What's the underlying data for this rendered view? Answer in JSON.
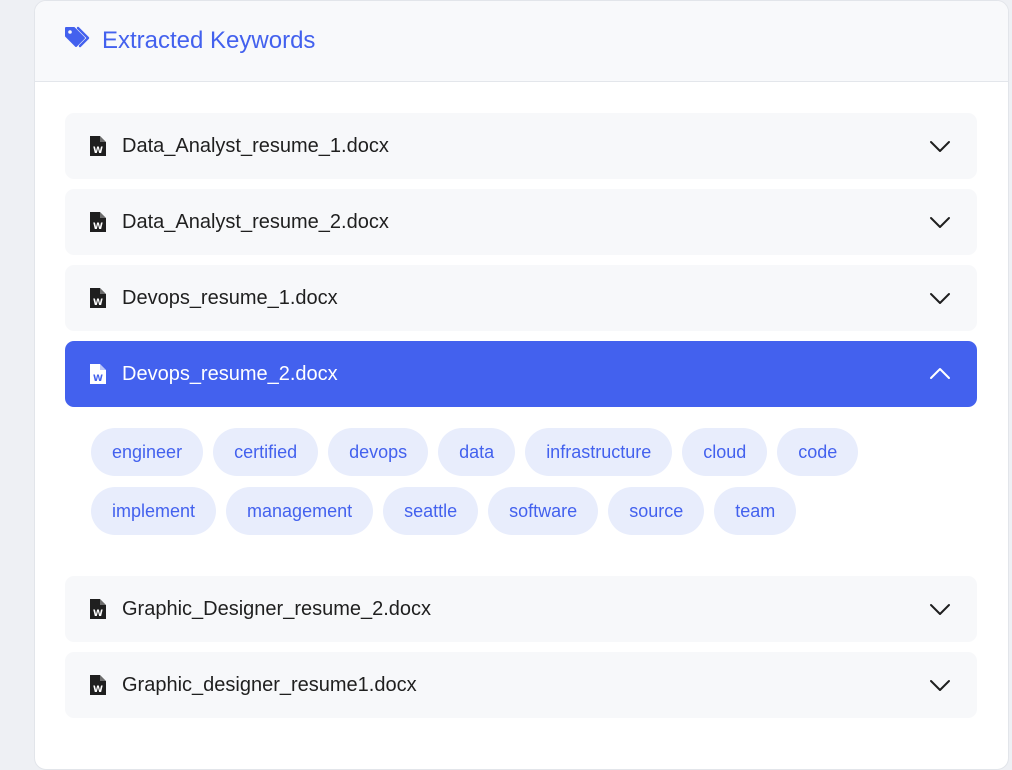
{
  "header": {
    "title": "Extracted Keywords",
    "icon": "tags-icon"
  },
  "accent_color": "#4361ee",
  "files": [
    {
      "name": "Data_Analyst_resume_1.docx",
      "expanded": false
    },
    {
      "name": "Data_Analyst_resume_2.docx",
      "expanded": false
    },
    {
      "name": "Devops_resume_1.docx",
      "expanded": false
    },
    {
      "name": "Devops_resume_2.docx",
      "expanded": true,
      "keywords": [
        "engineer",
        "certified",
        "devops",
        "data",
        "infrastructure",
        "cloud",
        "code",
        "implement",
        "management",
        "seattle",
        "software",
        "source",
        "team"
      ]
    },
    {
      "name": "Graphic_Designer_resume_2.docx",
      "expanded": false
    },
    {
      "name": "Graphic_designer_resume1.docx",
      "expanded": false
    }
  ]
}
